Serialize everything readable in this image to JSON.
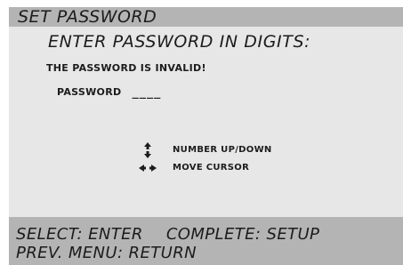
{
  "title": "SET PASSWORD",
  "instruction": "ENTER PASSWORD IN DIGITS:",
  "message": "THE PASSWORD IS INVALID!",
  "password": {
    "label": "PASSWORD",
    "value": "____"
  },
  "hints": [
    {
      "icon": "up-down-arrows-icon",
      "label": "NUMBER UP/DOWN"
    },
    {
      "icon": "left-right-arrows-icon",
      "label": "MOVE CURSOR"
    }
  ],
  "footer": {
    "select": "SELECT: ENTER",
    "complete": "COMPLETE: SETUP",
    "prev_menu": "PREV. MENU: RETURN"
  },
  "colors": {
    "bar_background": "#b4b4b4",
    "body_background": "#e7e7e7",
    "text": "#1c1c1c"
  }
}
